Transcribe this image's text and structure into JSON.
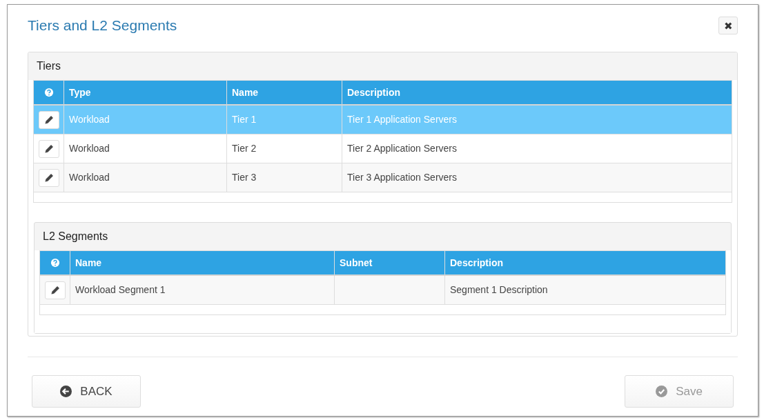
{
  "dialog": {
    "title": "Tiers and L2 Segments",
    "close_icon": "✖"
  },
  "panels": [
    {
      "title": "Tiers",
      "columns": [
        "Type",
        "Name",
        "Description"
      ],
      "rows": [
        {
          "selected": true,
          "cells": [
            "Workload",
            "Tier 1",
            "Tier 1 Application Servers"
          ]
        },
        {
          "selected": false,
          "cells": [
            "Workload",
            "Tier 2",
            "Tier 2 Application Servers"
          ]
        },
        {
          "selected": false,
          "cells": [
            "Workload",
            "Tier 3",
            "Tier 3 Application Servers"
          ]
        }
      ]
    },
    {
      "title": "L2 Segments",
      "columns": [
        "Name",
        "Subnet",
        "Description"
      ],
      "rows": [
        {
          "selected": false,
          "cells": [
            "Workload Segment 1",
            null,
            "Segment 1 Description"
          ]
        }
      ]
    }
  ],
  "buttons": [
    {
      "label": "BACK",
      "kind": "back",
      "disabled": false
    },
    {
      "label": "Save",
      "kind": "save",
      "disabled": true
    }
  ]
}
